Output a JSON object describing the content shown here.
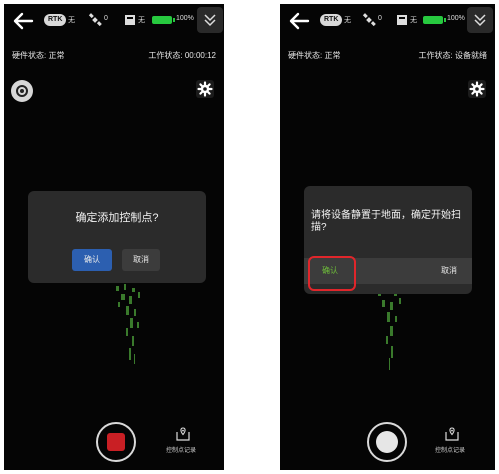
{
  "left": {
    "status_bar": {
      "rtk_label": "RTK",
      "rtk_value": "无",
      "satellite_count": "0",
      "map_value": "无",
      "battery_percent": "100%"
    },
    "hardware_status": "硬件状态: 正常",
    "work_status": "工作状态: 00:00:12",
    "dialog": {
      "title": "确定添加控制点?",
      "confirm_label": "确认",
      "cancel_label": "取消"
    },
    "control_point_label": "控制点记录"
  },
  "right": {
    "status_bar": {
      "rtk_label": "RTK",
      "rtk_value": "无",
      "satellite_count": "0",
      "map_value": "无",
      "battery_percent": "100%"
    },
    "hardware_status": "硬件状态: 正常",
    "work_status": "工作状态: 设备就绪",
    "dialog": {
      "message": "请将设备静置于地面，确定开始扫描?",
      "confirm_label": "确认",
      "cancel_label": "取消"
    },
    "control_point_label": "控制点记录"
  },
  "colors": {
    "background": "#050505",
    "dialog": "#2b2b2b",
    "confirm_blue": "#2c5fb0",
    "confirm_green_text": "#6fbf3a",
    "battery_green": "#27c93f",
    "record_red": "#c91f24",
    "highlight_red": "#e0262b"
  },
  "icons": [
    "back-arrow-icon",
    "satellite-icon",
    "map-icon",
    "battery-icon",
    "chevron-down-icon",
    "gear-icon",
    "camera-switch-icon",
    "control-point-icon"
  ]
}
